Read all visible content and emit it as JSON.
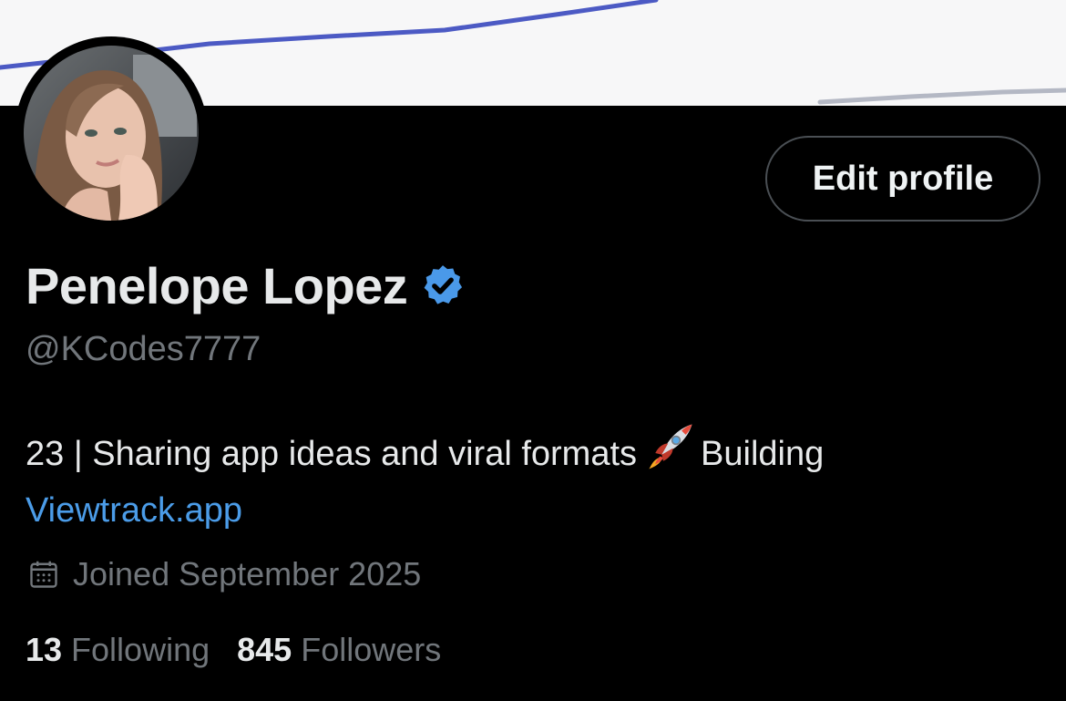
{
  "profile": {
    "display_name": "Penelope Lopez",
    "verified": true,
    "handle": "@KCodes7777",
    "bio_text": "23 | Sharing app ideas and viral formats",
    "bio_emoji": "rocket-emoji",
    "bio_text_after": "Building",
    "bio_link": "Viewtrack.app",
    "joined": "Joined September 2025"
  },
  "actions": {
    "edit_profile_label": "Edit profile"
  },
  "stats": {
    "following_count": "13",
    "following_label": "Following",
    "followers_count": "845",
    "followers_label": "Followers"
  },
  "colors": {
    "background": "#000000",
    "primary_text": "#e7e9ea",
    "secondary_text": "#71767b",
    "link": "#4b9ce8",
    "verified_badge": "#4a99e9",
    "button_border": "#4a4f54"
  },
  "icons": {
    "verified": "verified-badge-icon",
    "joined": "calendar-icon"
  }
}
